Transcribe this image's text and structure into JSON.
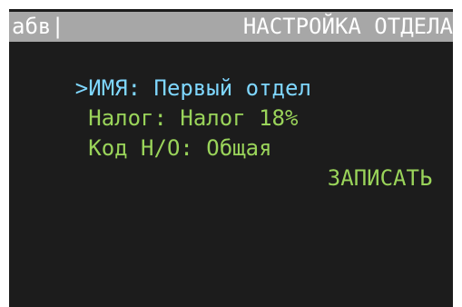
{
  "header": {
    "input_mode": "абв|",
    "title": "НАСТРОЙКА ОТДЕЛА"
  },
  "menu": [
    {
      "cursor": ">",
      "label": "ИМЯ: Первый отдел"
    },
    {
      "cursor": " ",
      "label": "Налог: Налог 18%"
    },
    {
      "cursor": " ",
      "label": "Код Н/О: Общая"
    }
  ],
  "action": {
    "label": "ЗАПИСАТЬ"
  },
  "colors": {
    "background": "#1c1c1c",
    "header_background": "#a7a7a7",
    "selected_text": "#7fd7ff",
    "normal_text": "#9ad45a"
  }
}
